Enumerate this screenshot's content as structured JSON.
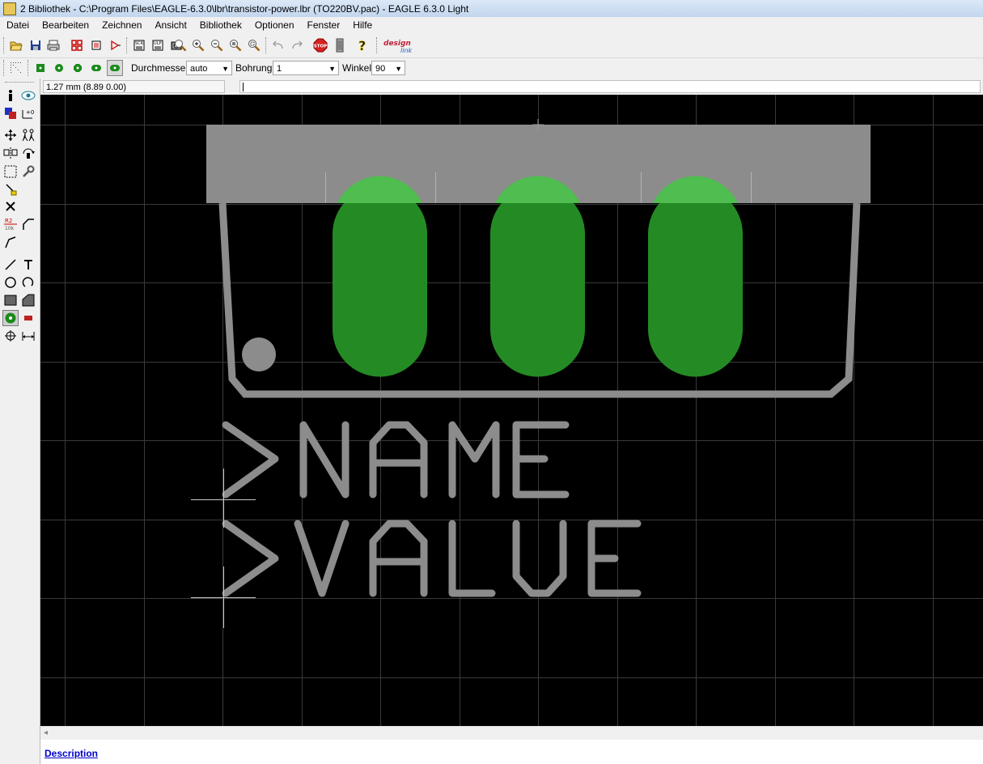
{
  "window": {
    "title": "2 Bibliothek - C:\\Program Files\\EAGLE-6.3.0\\lbr\\transistor-power.lbr (TO220BV.pac) - EAGLE 6.3.0 Light"
  },
  "menu": [
    "Datei",
    "Bearbeiten",
    "Zeichnen",
    "Ansicht",
    "Bibliothek",
    "Optionen",
    "Fenster",
    "Hilfe"
  ],
  "toolbar": {
    "icons": [
      "open-icon",
      "save-icon",
      "print-icon",
      "board-icon",
      "schematic-icon",
      "symbol-icon",
      "script-icon",
      "ulp-icon",
      "cam-icon",
      "zoom-fit-icon",
      "zoom-in-icon",
      "zoom-out-icon",
      "zoom-redraw-icon",
      "zoom-select-icon",
      "undo-icon",
      "redo-icon",
      "stop-icon",
      "go-icon",
      "help-icon",
      "design-link-icon"
    ],
    "design_link_label": [
      "design",
      "link"
    ],
    "stop_label": "STOP"
  },
  "params": {
    "diameter_label": "Durchmesser:",
    "diameter_value": "auto",
    "drill_label": "Bohrung:",
    "drill_value": "1",
    "angle_label": "Winkel:",
    "angle_value": "90"
  },
  "status": {
    "coordinates": "1.27 mm (8.89 0.00)",
    "command": ""
  },
  "colors": {
    "canvas_bg": "#000000",
    "grid": "#3a3a3a",
    "layer_gray": "#8c8c8c",
    "pad_green": "#248b24",
    "pad_overlap_green": "#4fbd4f",
    "origin_cross": "#b5b5b5"
  },
  "package": {
    "name_text": ">NAME",
    "value_text": ">VALUE",
    "pad_count": 3
  },
  "footer": {
    "description_link": "Description"
  }
}
